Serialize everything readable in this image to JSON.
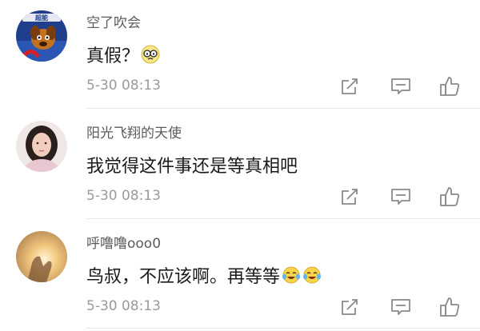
{
  "comments": [
    {
      "username": "空了吹会",
      "text": "真假？",
      "timestamp": "5-30 08:13",
      "emojis": [
        "glasses-face"
      ],
      "avatar": "cartoon-dog-avatar"
    },
    {
      "username": "阳光飞翔的天使",
      "text": "我觉得这件事还是等真相吧",
      "timestamp": "5-30 08:13",
      "emojis": [],
      "avatar": "girl-photo-avatar"
    },
    {
      "username": "呼噜噜ooo0",
      "text": "鸟叔，不应该啊。再等等",
      "timestamp": "5-30 08:13",
      "emojis": [
        "laughing-tears-face",
        "laughing-tears-face"
      ],
      "avatar": "sunset-hand-avatar"
    }
  ],
  "icons": {
    "repost": "repost-icon",
    "comment": "comment-icon",
    "like": "thumb-up-icon"
  },
  "colors": {
    "username": "#5b5b5b",
    "text": "#1a1a1a",
    "timestamp": "#9a9a9a",
    "icon": "#8a8a8a",
    "divider": "#e6e6e6"
  }
}
